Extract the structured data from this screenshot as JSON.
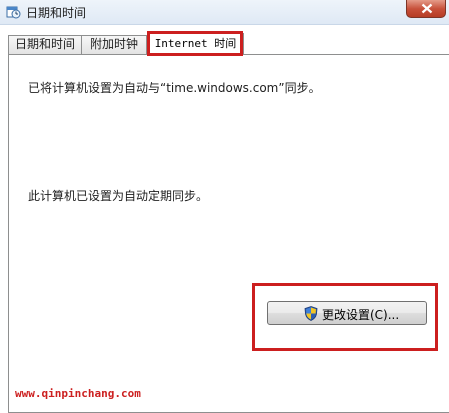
{
  "window": {
    "title": "日期和时间",
    "title_icon": "date-time-icon",
    "close_icon": "close-icon"
  },
  "tabs": [
    {
      "label": "日期和时间",
      "active": false
    },
    {
      "label": "附加时钟",
      "active": false
    },
    {
      "label": "Internet 时间",
      "active": true
    }
  ],
  "content": {
    "sync_status_text": "已将计算机设置为自动与“time.windows.com”同步。",
    "schedule_text": "此计算机已设置为自动定期同步。",
    "change_settings_button": "更改设置(C)...",
    "button_icon": "uac-shield-icon"
  },
  "watermark": "www.qinpinchang.com",
  "colors": {
    "highlight_box": "#cc1f1f",
    "watermark": "#cc1f1f",
    "titlebar": "#dfe9f5",
    "close_button": "#c7503a"
  }
}
